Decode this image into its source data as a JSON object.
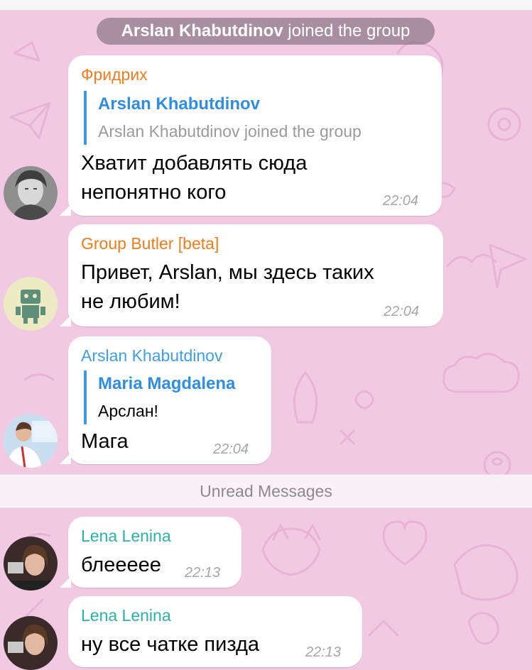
{
  "service_message": {
    "name": "Arslan Khabutdinov",
    "action": "joined the group"
  },
  "messages": [
    {
      "sender": "Фридрих",
      "sender_color": "#f07d1d",
      "reply": {
        "name": "Arslan Khabutdinov",
        "text": "Arslan Khabutdinov joined the group"
      },
      "text_lines": [
        "Хватит добавлять сюда",
        "непонятно кого"
      ],
      "time": "22:04"
    },
    {
      "sender": "Group Butler [beta]",
      "sender_color": "#f07d1d",
      "text_lines": [
        "Привет, Arslan, мы здесь таких",
        "не любим!"
      ],
      "time": "22:04"
    },
    {
      "sender": "Arslan Khabutdinov",
      "sender_color": "#3f9fe4",
      "reply": {
        "name": "Maria Magdalena",
        "text": "Арслан!"
      },
      "text_lines": [
        "Мага"
      ],
      "time": "22:04"
    },
    {
      "sender": "Lena Lenina",
      "sender_color": "#2bb3a0",
      "text_lines": [
        "блеееее"
      ],
      "time": "22:13"
    },
    {
      "sender": "Lena Lenina",
      "sender_color": "#2bb3a0",
      "text_lines": [
        "ну все чатке пизда"
      ],
      "time": "22:13"
    }
  ],
  "unread_divider": "Unread Messages",
  "colors": {
    "background": "#f2c9e3",
    "reply_bar": "#3f98e6",
    "time": "#a6a6a6"
  }
}
